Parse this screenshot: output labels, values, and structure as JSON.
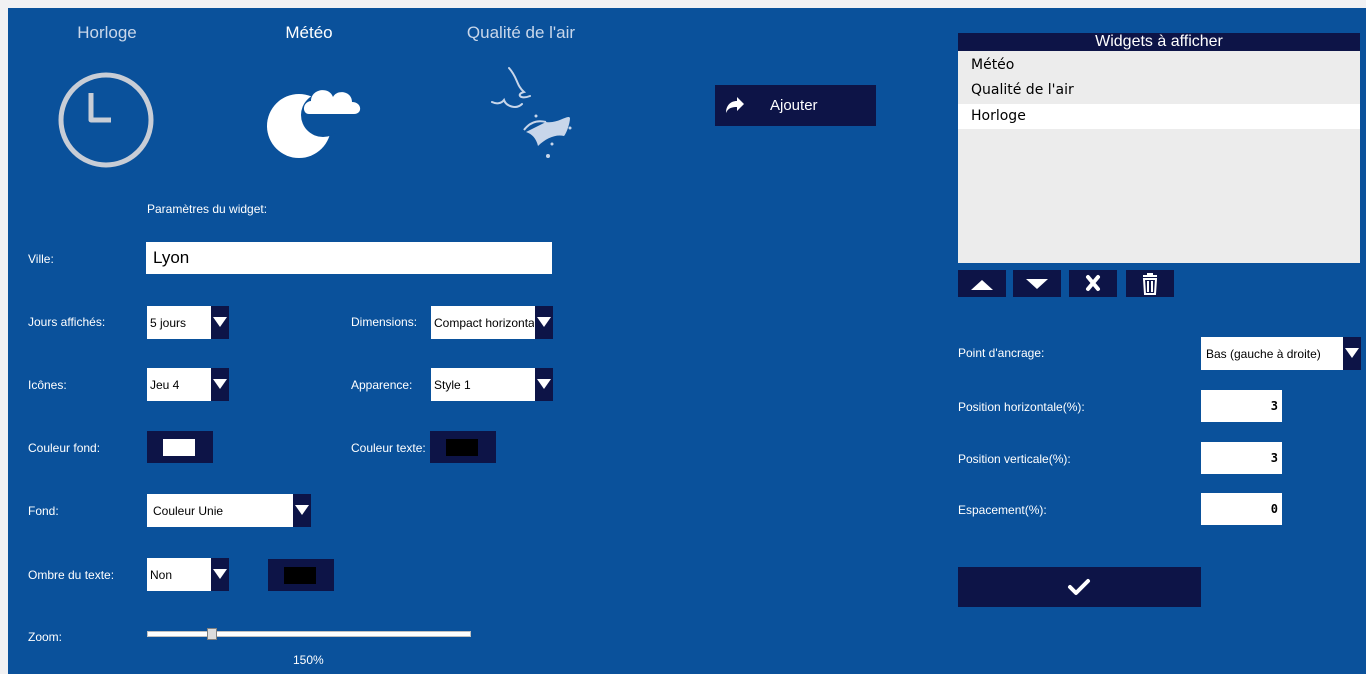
{
  "tabs": [
    {
      "label": "Horloge",
      "icon": "clock-icon",
      "active": false
    },
    {
      "label": "Météo",
      "icon": "weather-icon",
      "active": true
    },
    {
      "label": "Qualité de l'air",
      "icon": "air-quality-icon",
      "active": false
    }
  ],
  "add_button": {
    "label": "Ajouter",
    "icon": "share-arrow-icon"
  },
  "settings": {
    "section_title": "Paramètres du widget:",
    "city": {
      "label": "Ville:",
      "value": "Lyon"
    },
    "days": {
      "label": "Jours affichés:",
      "value": "5 jours"
    },
    "dimensions": {
      "label": "Dimensions:",
      "value": "Compact horizontal"
    },
    "icons": {
      "label": "Icônes:",
      "value": "Jeu 4"
    },
    "appearance": {
      "label": "Apparence:",
      "value": "Style 1"
    },
    "bg_color": {
      "label": "Couleur fond:",
      "color": "#ffffff"
    },
    "text_color": {
      "label": "Couleur texte:",
      "color": "#000000"
    },
    "background": {
      "label": "Fond:",
      "value": "Couleur Unie"
    },
    "text_shadow": {
      "label": "Ombre du texte:",
      "value": "Non",
      "color": "#000000"
    },
    "zoom": {
      "label": "Zoom:",
      "value": "150%",
      "fraction": 0.19
    }
  },
  "widgets_list": {
    "title": "Widgets à afficher",
    "items": [
      "Météo",
      "Qualité de l'air",
      "Horloge"
    ],
    "selected_index": 2
  },
  "list_controls": [
    "move-up-icon",
    "move-down-icon",
    "remove-icon",
    "trash-icon"
  ],
  "position": {
    "anchor": {
      "label": "Point d'ancrage:",
      "value": "Bas (gauche à droite)"
    },
    "horizontal": {
      "label": "Position horizontale(%):",
      "value": "3"
    },
    "vertical": {
      "label": "Position verticale(%):",
      "value": "3"
    },
    "spacing": {
      "label": "Espacement(%):",
      "value": "0"
    }
  },
  "confirm_button": {
    "icon": "checkmark-icon"
  },
  "colors": {
    "background": "#0a519b",
    "navy": "#0d1447",
    "page": "#f1f1f3"
  }
}
